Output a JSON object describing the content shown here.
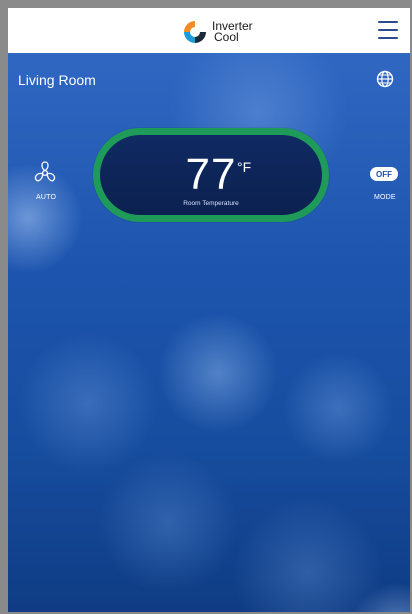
{
  "header": {
    "logo_line1": "Inverter",
    "logo_line2": "Cool",
    "menu_icon": "hamburger-menu-icon",
    "colors": {
      "logo_orange": "#f28c28",
      "logo_blue": "#1f9bd7",
      "logo_dark": "#1e2a3a"
    }
  },
  "room": {
    "name": "Living Room",
    "region_icon": "globe-icon"
  },
  "fan": {
    "icon": "fan-icon",
    "label": "AUTO"
  },
  "mode": {
    "badge": "OFF",
    "label": "MODE"
  },
  "temperature": {
    "value": "77",
    "unit": "°F",
    "label": "Room Temperature",
    "ring_color": "#1e9b58"
  }
}
